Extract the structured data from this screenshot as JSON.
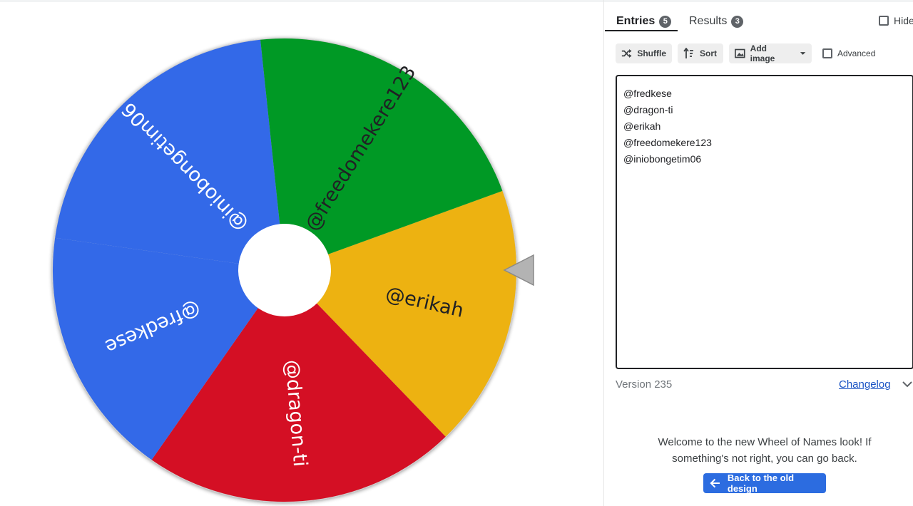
{
  "wheel": {
    "slices": [
      {
        "label": "@erikah",
        "color": "#EDB211",
        "start": -20,
        "end": 46
      },
      {
        "label": "@dragon-ti",
        "color": "#D40F24",
        "start": 46,
        "end": 125
      },
      {
        "label": "@fredkese",
        "color": "#3369E8",
        "start": 125,
        "end": 188
      },
      {
        "label": "@iniobongetim06",
        "color": "#3369E8",
        "start": 188,
        "end": 264
      },
      {
        "label": "@freedomekere123",
        "color": "#009925",
        "start": 264,
        "end": 340
      }
    ],
    "text_color_light": "#ffffff",
    "text_color_dark": "#202124"
  },
  "tabs": {
    "entries": {
      "label": "Entries",
      "count": "5"
    },
    "results": {
      "label": "Results",
      "count": "3"
    }
  },
  "hide": {
    "label": "Hide"
  },
  "toolbar": {
    "shuffle_label": "Shuffle",
    "sort_label": "Sort",
    "add_image_label": "Add image",
    "advanced_label": "Advanced"
  },
  "entries": [
    "@fredkese",
    "@dragon-ti",
    "@erikah",
    "@freedomekere123",
    "@iniobongetim06"
  ],
  "footer": {
    "version": "Version 235",
    "changelog": "Changelog"
  },
  "welcome": {
    "line1": "Welcome to the new Wheel of Names look! If",
    "line2": "something's not right, you can go back.",
    "button": "Back to the old design"
  },
  "colors": {
    "accent": "#2C6CE0",
    "link": "#1A53C4"
  }
}
